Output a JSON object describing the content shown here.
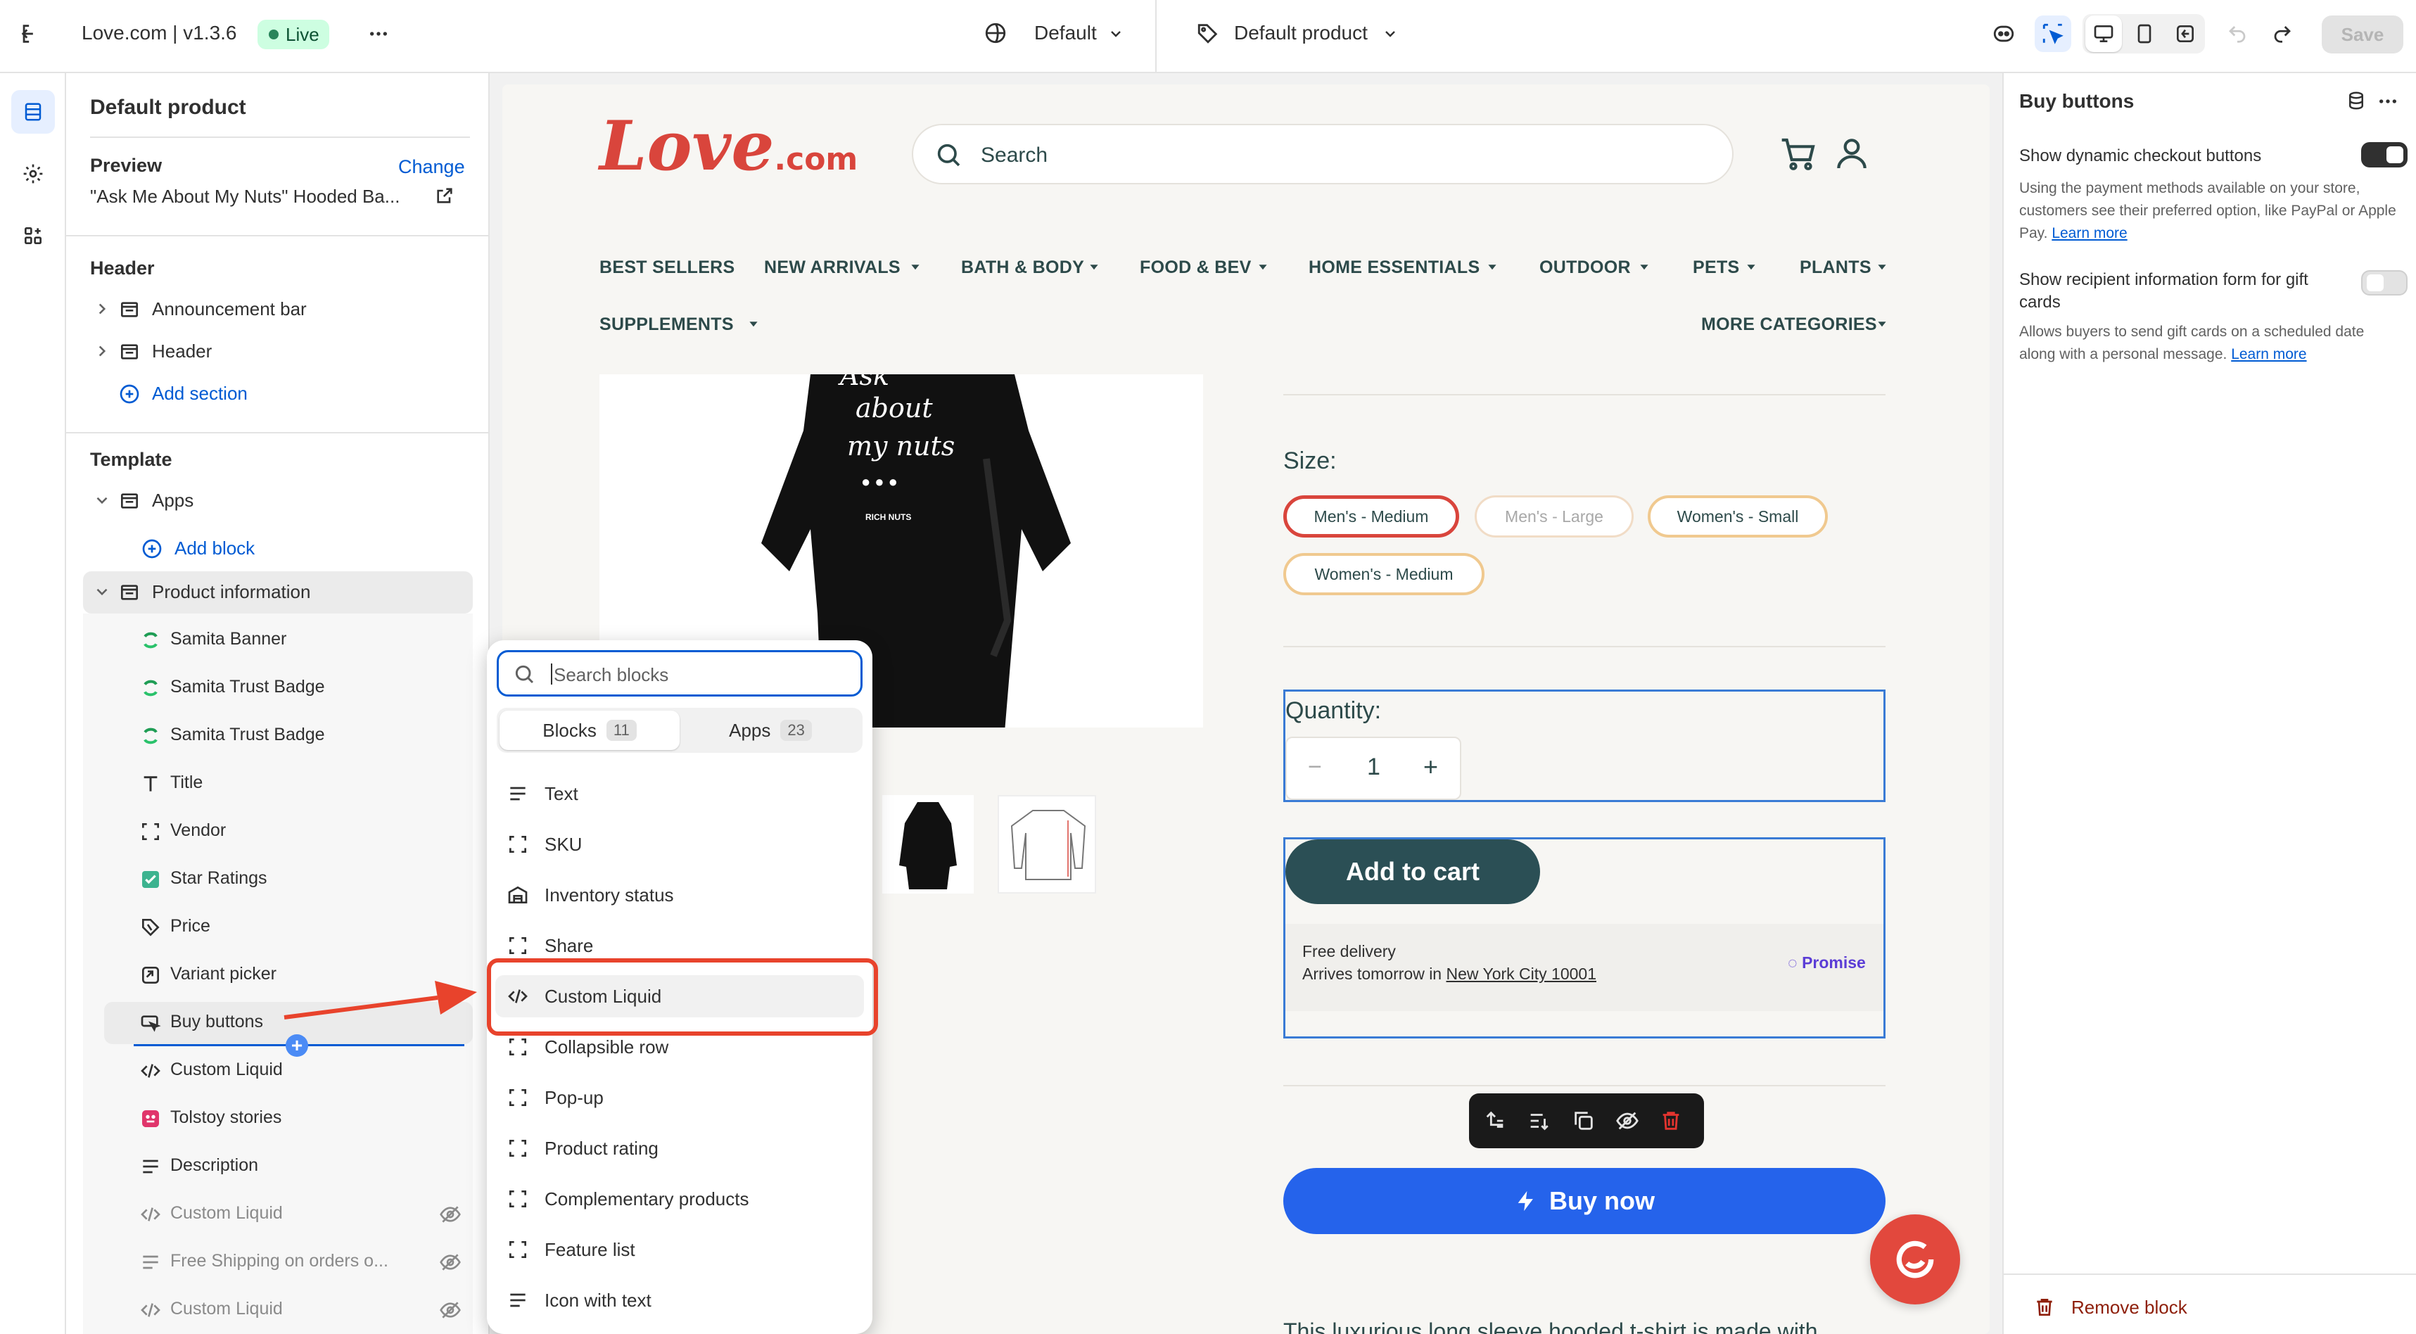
{
  "topbar": {
    "store_name": "Love.com | v1.3.6",
    "live_badge": "Live",
    "theme_select": "Default",
    "template_select": "Default product",
    "save_label": "Save"
  },
  "left_panel": {
    "title": "Default product",
    "preview_label": "Preview",
    "change_link": "Change",
    "preview_product": "\"Ask Me About My Nuts\" Hooded Ba...",
    "header_group": "Header",
    "header_items": [
      "Announcement bar",
      "Header"
    ],
    "add_section": "Add section",
    "template_group": "Template",
    "apps_label": "Apps",
    "add_block": "Add block",
    "product_info_label": "Product information",
    "blocks": [
      "Samita Banner",
      "Samita Trust Badge",
      "Samita Trust Badge",
      "Title",
      "Vendor",
      "Star Ratings",
      "Price",
      "Variant picker",
      "Buy buttons",
      "Custom Liquid",
      "Tolstoy stories",
      "Description",
      "Custom Liquid",
      "Free Shipping on orders o...",
      "Custom Liquid"
    ]
  },
  "store": {
    "logo_main": "Love",
    "logo_suffix": ".com",
    "search_placeholder": "Search",
    "nav": [
      "BEST SELLERS",
      "NEW ARRIVALS",
      "BATH & BODY",
      "FOOD & BEV",
      "HOME ESSENTIALS",
      "OUTDOOR",
      "PETS",
      "PLANTS",
      "SUPPLEMENTS",
      "MORE CATEGORIES"
    ],
    "shirt_text": [
      "Ask",
      "about",
      "my nuts",
      "RICH NUTS"
    ],
    "size_label": "Size:",
    "sizes": [
      "Men's - Medium",
      "Men's - Large",
      "Women's - Small",
      "Women's - Medium"
    ],
    "quantity_label": "Quantity:",
    "quantity_minus": "−",
    "quantity_value": "1",
    "quantity_plus": "+",
    "add_to_cart": "Add to cart",
    "free_delivery": "Free delivery",
    "arrives_prefix": "Arrives tomorrow in",
    "arrives_location": "New York City 10001",
    "promise_brand": "Promise",
    "buy_now": "Buy now",
    "description_snippet": "This luxurious long sleeve hooded t-shirt is made with"
  },
  "block_picker": {
    "search_placeholder": "Search blocks",
    "tab_blocks": "Blocks",
    "tab_blocks_count": "11",
    "tab_apps": "Apps",
    "tab_apps_count": "23",
    "items": [
      "Text",
      "SKU",
      "Inventory status",
      "Share",
      "Custom Liquid",
      "Collapsible row",
      "Pop-up",
      "Product rating",
      "Complementary products",
      "Feature list",
      "Icon with text"
    ]
  },
  "right_panel": {
    "title": "Buy buttons",
    "dynamic_label": "Show dynamic checkout buttons",
    "dynamic_help": "Using the payment methods available on your store, customers see their preferred option, like PayPal or Apple Pay.",
    "learn_more": "Learn more",
    "recipient_label": "Show recipient information form for gift cards",
    "recipient_help": "Allows buyers to send gift cards on a scheduled date along with a personal message.",
    "remove_block": "Remove block"
  },
  "colors": {
    "accent_blue": "#005bd3",
    "annotation_red": "#e8432c",
    "brand_red": "#d9453c",
    "cart_button": "#2b4f55",
    "buy_now_blue": "#2563eb"
  }
}
